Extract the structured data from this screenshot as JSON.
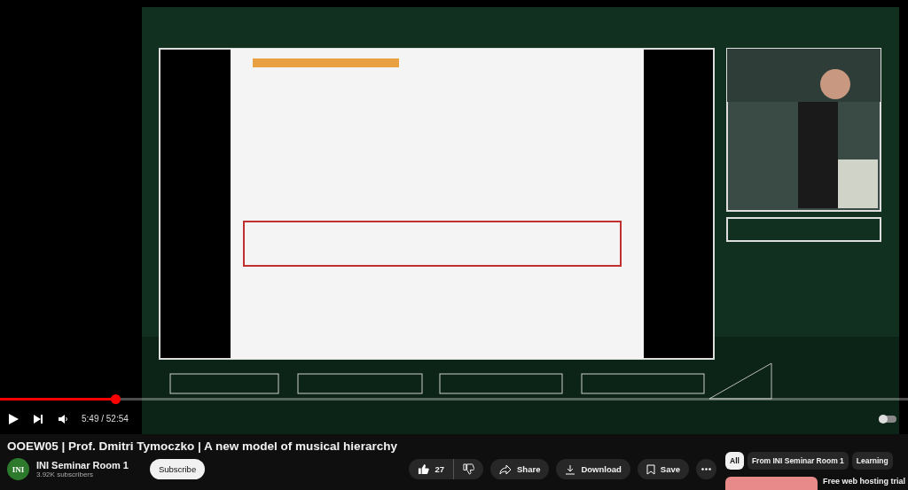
{
  "player": {
    "progress": {
      "level": 0.127
    },
    "time": "5:49 / 52:54"
  },
  "video": {
    "title": "OOEW05 | Prof. Dmitri Tymoczko | A new model of musical hierarchy"
  },
  "channel": {
    "avatar_text": "INI",
    "name": "INI Seminar Room 1",
    "subscribers": "3.92K subscribers",
    "subscribe_label": "Subscribe"
  },
  "actions": {
    "likes": "27",
    "share": "Share",
    "download": "Download",
    "save": "Save"
  },
  "chips": [
    {
      "label": "All",
      "selected": true
    },
    {
      "label": "From INI Seminar Room 1",
      "selected": false
    },
    {
      "label": "Learning",
      "selected": false
    }
  ],
  "ad": {
    "title": "Free web hosting trial"
  }
}
